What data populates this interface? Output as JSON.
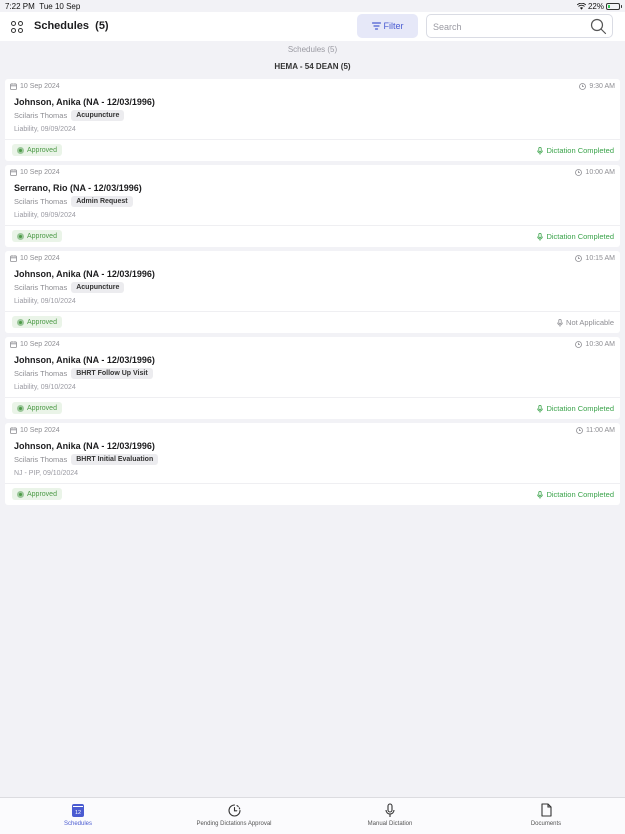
{
  "status_bar": {
    "time": "7:22 PM",
    "date": "Tue 10 Sep",
    "battery": "22%"
  },
  "header": {
    "title": "Schedules",
    "count": "(5)",
    "filter_label": "Filter",
    "search_placeholder": "Search"
  },
  "section_title": "Schedules (5)",
  "group_title": "HEMA - 54 DEAN (5)",
  "appointments": [
    {
      "date": "10 Sep 2024",
      "time": "9:30 AM",
      "patient": "Johnson, Anika (NA - 12/03/1996)",
      "provider": "Scilaris Thomas",
      "visit_type": "Acupuncture",
      "insurance": "Liability, 09/09/2024",
      "status": "Approved",
      "dictation": "Dictation Completed"
    },
    {
      "date": "10 Sep 2024",
      "time": "10:00 AM",
      "patient": "Serrano, Rio (NA - 12/03/1996)",
      "provider": "Scilaris Thomas",
      "visit_type": "Admin Request",
      "insurance": "Liability, 09/09/2024",
      "status": "Approved",
      "dictation": "Dictation Completed"
    },
    {
      "date": "10 Sep 2024",
      "time": "10:15 AM",
      "patient": "Johnson, Anika (NA - 12/03/1996)",
      "provider": "Scilaris Thomas",
      "visit_type": "Acupuncture",
      "insurance": "Liability, 09/10/2024",
      "status": "Approved",
      "dictation": "Not Applicable"
    },
    {
      "date": "10 Sep 2024",
      "time": "10:30 AM",
      "patient": "Johnson, Anika (NA - 12/03/1996)",
      "provider": "Scilaris Thomas",
      "visit_type": "BHRT Follow Up Visit",
      "insurance": "Liability, 09/10/2024",
      "status": "Approved",
      "dictation": "Dictation Completed"
    },
    {
      "date": "10 Sep 2024",
      "time": "11:00 AM",
      "patient": "Johnson, Anika (NA - 12/03/1996)",
      "provider": "Scilaris Thomas",
      "visit_type": "BHRT Initial Evaluation",
      "insurance": "NJ - PIP, 09/10/2024",
      "status": "Approved",
      "dictation": "Dictation Completed"
    }
  ],
  "tab_bar": {
    "calendar_day": "12",
    "tabs": [
      {
        "label": "Schedules",
        "icon": "calendar-icon"
      },
      {
        "label": "Pending Dictations Approval",
        "icon": "clock-icon"
      },
      {
        "label": "Manual Dictation",
        "icon": "microphone-icon"
      },
      {
        "label": "Documents",
        "icon": "document-icon"
      }
    ]
  },
  "colors": {
    "accent": "#4a5bd1",
    "approved": "#4c9a46",
    "completed": "#3aa34a"
  }
}
